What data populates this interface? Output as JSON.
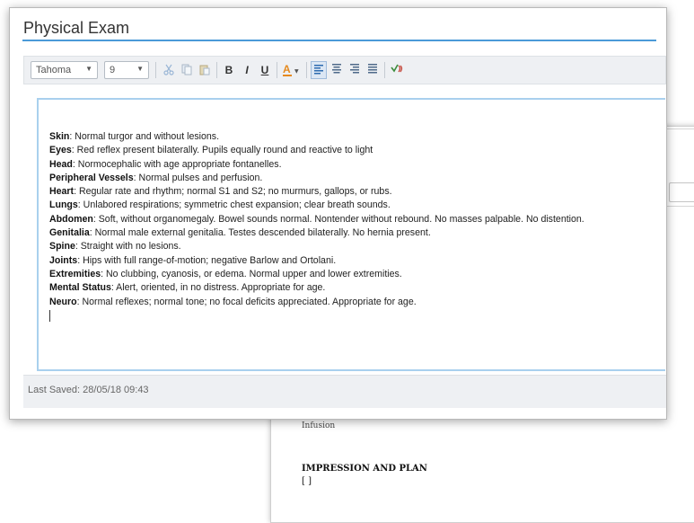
{
  "dialog": {
    "title": "Physical Exam"
  },
  "toolbar": {
    "font_family": "Tahoma",
    "font_size": "9",
    "bold_label": "B",
    "italic_label": "I",
    "underline_label": "U",
    "icons": [
      "cut-icon",
      "copy-icon",
      "paste-icon",
      "font-color-icon",
      "align-left-icon",
      "align-center-icon",
      "align-right-icon",
      "justify-icon",
      "spell-check-icon"
    ]
  },
  "exam": [
    {
      "label": "Skin",
      "text": ": Normal turgor and without lesions."
    },
    {
      "label": "Eyes",
      "text": ": Red reflex present bilaterally. Pupils equally round and reactive to light"
    },
    {
      "label": "Head",
      "text": ": Normocephalic with age appropriate fontanelles."
    },
    {
      "label": "Peripheral Vessels",
      "text": ": Normal pulses and perfusion."
    },
    {
      "label": "Heart",
      "text": ": Regular rate and rhythm; normal S1 and S2; no murmurs, gallops, or rubs."
    },
    {
      "label": "Lungs",
      "text": ": Unlabored respirations; symmetric chest expansion; clear breath sounds."
    },
    {
      "label": "Abdomen",
      "text": ": Soft, without organomegaly. Bowel sounds normal. Nontender without rebound. No masses palpable. No distention."
    },
    {
      "label": "Genitalia",
      "text": ": Normal male external genitalia. Testes descended bilaterally. No hernia present."
    },
    {
      "label": "Spine",
      "text": ": Straight with no lesions."
    },
    {
      "label": "Joints",
      "text": ": Hips with full range-of-motion; negative Barlow and Ortolani."
    },
    {
      "label": "Extremities",
      "text": ": No clubbing, cyanosis, or edema. Normal upper and lower extremities."
    },
    {
      "label": "Mental Status",
      "text": ": Alert, oriented, in no distress. Appropriate for age."
    },
    {
      "label": "Neuro",
      "text": ": Normal reflexes; normal tone; no focal deficits appreciated. Appropriate for age."
    }
  ],
  "status": {
    "last_saved": "Last Saved: 28/05/18 09:43"
  },
  "background_doc": {
    "infusion": "Infusion",
    "impression_heading": "IMPRESSION AND PLAN",
    "impression_value": "[ ]"
  },
  "colors": {
    "accent": "#4a9ad8",
    "editor_border": "#a9d0ee",
    "toolbar_bg": "#eef0f3"
  }
}
